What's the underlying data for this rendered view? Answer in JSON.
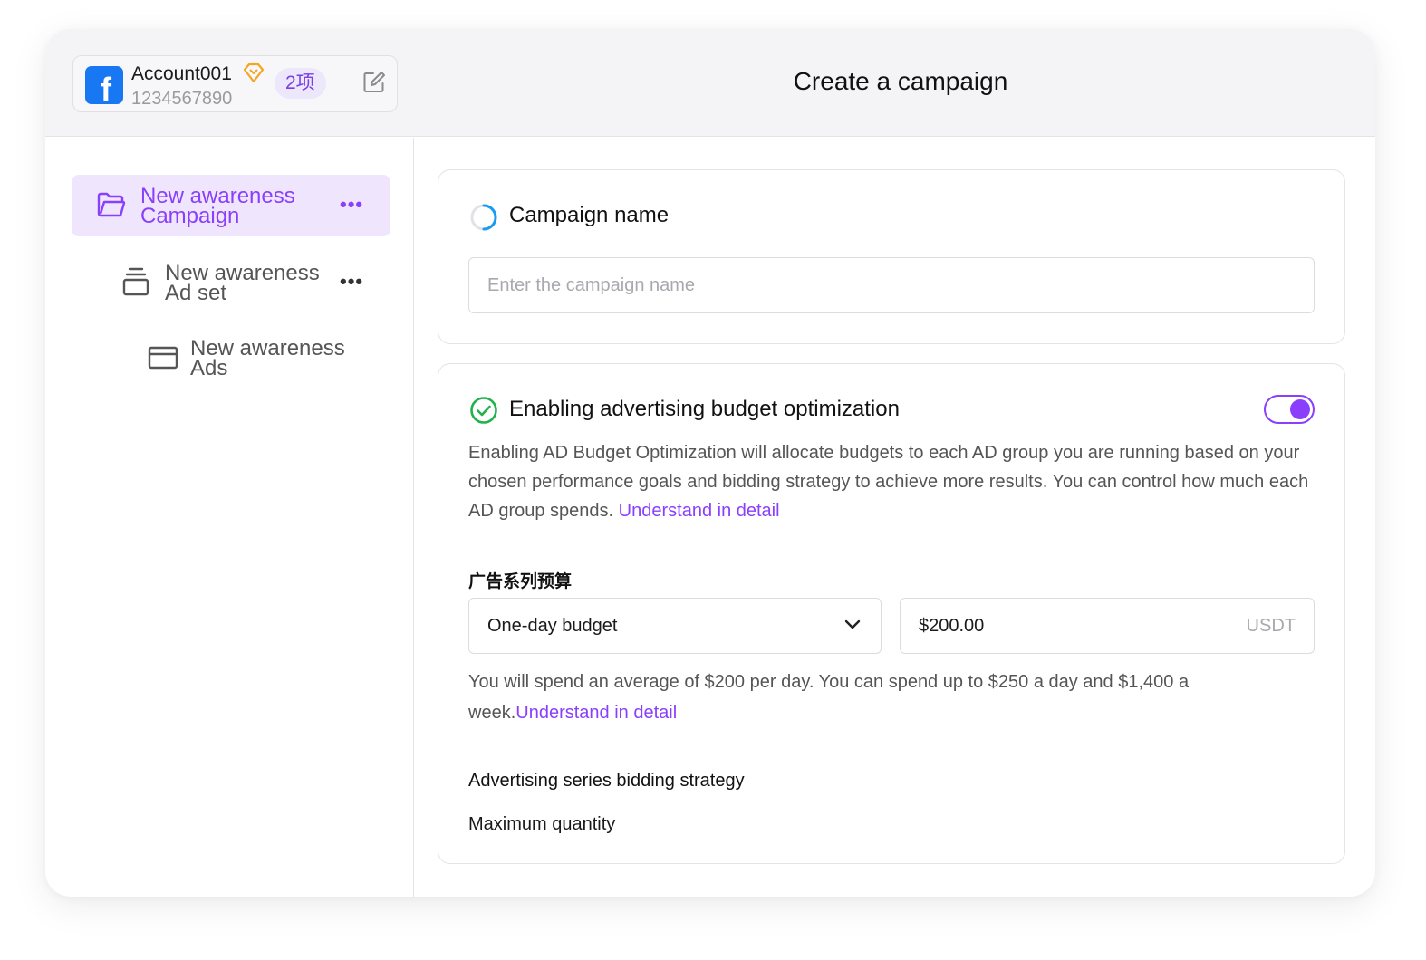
{
  "account": {
    "name": "Account001",
    "id": "1234567890",
    "count_badge": "2项"
  },
  "header": {
    "title": "Create a campaign"
  },
  "tree": {
    "campaign": {
      "label": "New awareness Campaign",
      "more": "•••"
    },
    "adset": {
      "label": "New awareness Ad set",
      "more": "•••"
    },
    "ads": {
      "label": "New awareness Ads"
    }
  },
  "campaign_name": {
    "title": "Campaign name",
    "placeholder": "Enter the campaign name",
    "value": ""
  },
  "budget_optimization": {
    "title": "Enabling advertising budget optimization",
    "enabled": true,
    "description": "Enabling AD Budget Optimization will allocate budgets to each AD group you are running based on your chosen performance goals and bidding strategy to achieve more results. You can control how much each AD group spends.",
    "link": "Understand in detail",
    "series_budget_label": "广告系列预算",
    "budget_type": "One-day budget",
    "amount": "$200.00",
    "currency": "USDT",
    "spend_note": "You will spend an average of $200 per day. You can spend up to $250 a day and $1,400 a week.",
    "spend_link": "Understand in detail",
    "strategy_label": "Advertising series bidding strategy",
    "strategy_value": "Maximum quantity"
  },
  "colors": {
    "accent": "#8a3ffc",
    "facebook": "#1877f2",
    "success": "#22b24c",
    "loading": "#1a9bf0",
    "diamond": "#f5a623"
  }
}
